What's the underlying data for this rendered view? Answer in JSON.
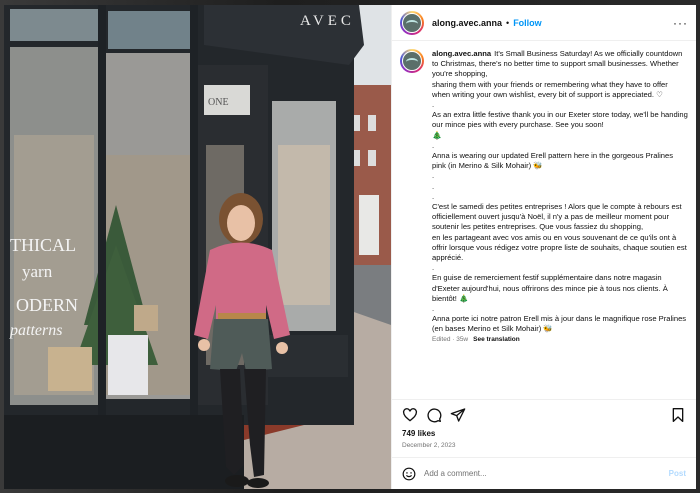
{
  "post": {
    "username": "along.avec.anna",
    "follow_label": "Follow",
    "more_label": "···",
    "caption_paragraphs": [
      "It's Small Business Saturday! As we officially countdown to Christmas, there's no better time to support small businesses. Whether you're shopping,",
      "sharing them with your friends or remembering what they have to offer when writing your own wishlist, every bit of support is appreciated. ♡",
      ".",
      "As an extra little festive thank you in our Exeter store today, we'll be handing our mince pies with every purchase. See you soon!",
      "🎄",
      ".",
      "Anna is wearing our updated Erell pattern here in the gorgeous Pralines pink (in Merino & Silk Mohair) 🐝",
      ".",
      ".",
      ".",
      "C'est le samedi des petites entreprises ! Alors que le compte à rebours est officiellement ouvert jusqu'à Noël, il n'y a pas de meilleur moment pour soutenir les petites entreprises. Que vous fassiez du shopping,",
      "en les partageant avec vos amis ou en vous souvenant de ce qu'ils ont à offrir lorsque vous rédigez votre propre liste de souhaits, chaque soutien est apprécié.",
      ".",
      "En guise de remerciement festif supplémentaire dans notre magasin d'Exeter aujourd'hui, nous offrirons des mince pie à tous nos clients. À bientôt! 🎄",
      ".",
      "Anna porte ici notre patron Erell mis à jour dans le magnifique rose Pralines (en bases Merino et Silk Mohair) 🐝"
    ],
    "edited_label": "Edited · 35w",
    "see_translation": "See translation",
    "likes": "749 likes",
    "date": "December 2, 2023",
    "comment_placeholder": "Add a comment...",
    "post_label": "Post"
  },
  "photo": {
    "sign_text": "AVEC",
    "window_lines": [
      "THICAL",
      "yarn",
      "ODERN",
      "patterns"
    ],
    "door_text": "ONE"
  },
  "icons": {
    "like": "heart-icon",
    "comment": "comment-icon",
    "share": "share-icon",
    "save": "bookmark-icon",
    "emoji": "emoji-icon"
  },
  "colors": {
    "link": "#0095f6",
    "post_disabled": "#b3dbff",
    "sweater": "#d06a86"
  }
}
